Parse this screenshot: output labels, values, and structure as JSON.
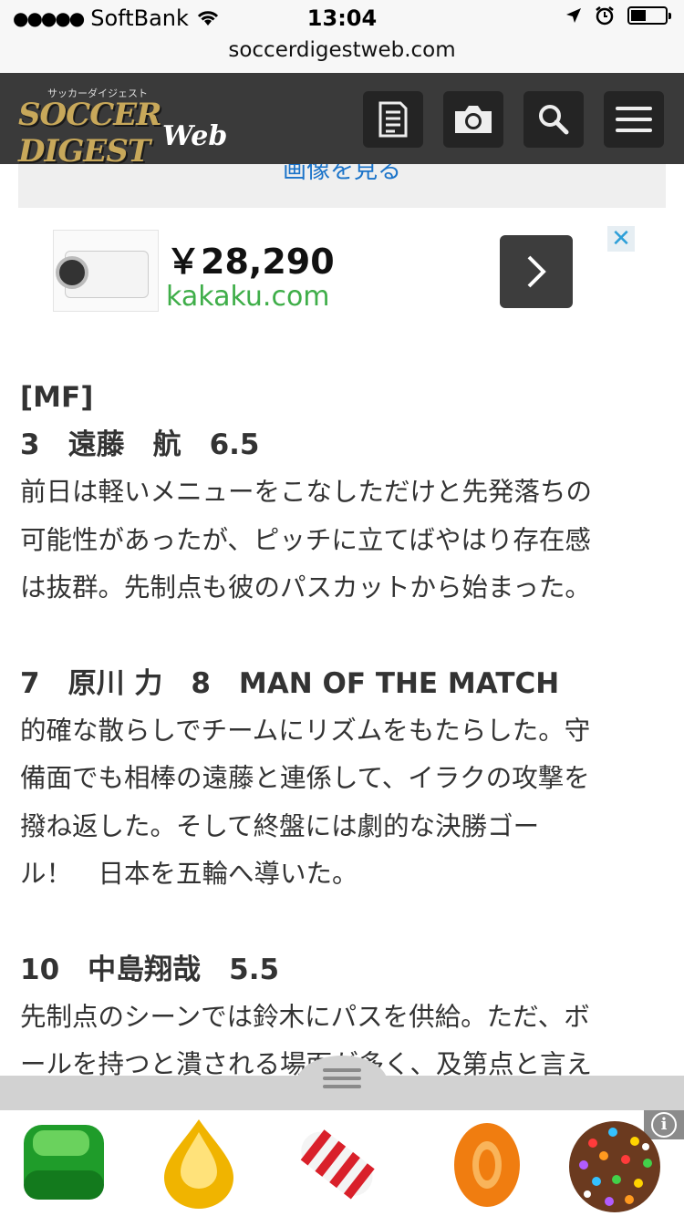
{
  "status_bar": {
    "signal": "●●●●●",
    "carrier": "SoftBank",
    "time": "13:04"
  },
  "url_bar": {
    "domain": "soccerdigestweb.com"
  },
  "header": {
    "logo_small": "サッカーダイジェスト",
    "logo_main": "SOCCER DIGEST",
    "logo_sub": "Web",
    "icons": [
      "article-list-icon",
      "camera-icon",
      "search-icon",
      "menu-icon"
    ]
  },
  "gallery_link": "画像を見る",
  "ad": {
    "price": "￥28,290",
    "site": "kakaku.com",
    "close": "✕",
    "accent_color": "#3fae49"
  },
  "article": {
    "section_label": "[MF]",
    "players": [
      {
        "heading": "3　遠藤　航　6.5",
        "lines": [
          "前日は軽いメニューをこなしただけと先発落ちの",
          "可能性があったが、ピッチに立てばやはり存在感",
          "は抜群。先制点も彼のパスカットから始まった。"
        ]
      },
      {
        "heading": "7　原川 力　8　MAN OF THE MATCH",
        "lines": [
          "的確な散らしでチームにリズムをもたらした。守",
          "備面でも相棒の遠藤と連係して、イラクの攻撃を",
          "撥ね返した。そして終盤には劇的な決勝ゴー",
          "ル！　日本を五輪へ導いた。"
        ]
      },
      {
        "heading": "10　中島翔哉　5.5",
        "lines": [
          "先制点のシーンでは鈴木にパスを供給。ただ、ボ",
          "ールを持つと潰される場面が多く、及第点と言え"
        ]
      }
    ]
  },
  "bottom_banner": {
    "info_symbol": "i",
    "candies": [
      "green-candy",
      "yellow-drop-candy",
      "striped-candy",
      "orange-candy",
      "color-bomb-candy"
    ]
  }
}
